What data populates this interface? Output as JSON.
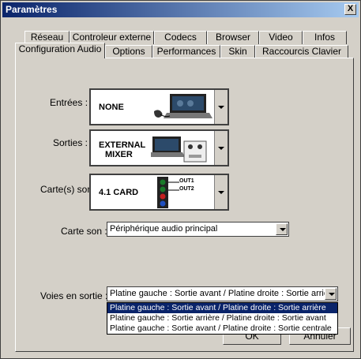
{
  "window": {
    "title": "Paramètres",
    "close_label": "X"
  },
  "tabs_row1": [
    "Réseau",
    "Controleur externe",
    "Codecs",
    "Browser",
    "Video",
    "Infos"
  ],
  "tabs_row2": [
    "Configuration Audio",
    "Options",
    "Performances",
    "Skin",
    "Raccourcis Clavier"
  ],
  "active_tab": "Configuration Audio",
  "entrees": {
    "label": "Entrées :",
    "value": "NONE"
  },
  "sorties": {
    "label": "Sorties :",
    "value_line1": "EXTERNAL",
    "value_line2": "MIXER"
  },
  "cartes": {
    "label": "Carte(s) son :",
    "value": "4.1 CARD",
    "out1": "OUT1",
    "out2": "OUT2"
  },
  "carte_son": {
    "label": "Carte son :",
    "value": "Périphérique audio principal"
  },
  "voies": {
    "label": "Voies en sortie :",
    "value": "Platine gauche : Sortie avant / Platine droite : Sortie arrière",
    "options": [
      "Platine gauche : Sortie avant / Platine droite : Sortie arrière",
      "Platine gauche : Sortie arrière / Platine droite : Sortie avant",
      "Platine gauche : Sortie avant / Platine droite : Sortie centrale"
    ],
    "selected_index": 0
  },
  "buttons": {
    "ok": "OK",
    "cancel": "Annuler"
  }
}
